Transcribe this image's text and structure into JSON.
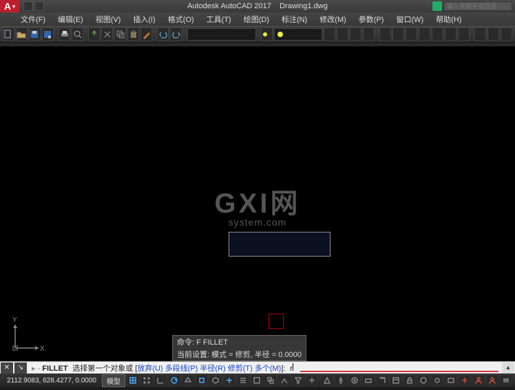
{
  "app": {
    "name": "Autodesk AutoCAD 2017",
    "document": "Drawing1.dwg",
    "search_placeholder": "输入关键字或短语"
  },
  "menu": [
    "文件(F)",
    "编辑(E)",
    "视图(V)",
    "插入(I)",
    "格式(O)",
    "工具(T)",
    "绘图(D)",
    "标注(N)",
    "修改(M)",
    "参数(P)",
    "窗口(W)",
    "帮助(H)"
  ],
  "watermark": {
    "line1": "GXI网",
    "line2": "system.com"
  },
  "ucs": {
    "x_label": "X",
    "y_label": "Y"
  },
  "command_history": [
    "命令: F FILLET",
    "当前设置: 模式 = 修剪, 半径 = 0.0000"
  ],
  "command_line": {
    "cmd": "FILLET",
    "prompt_pre": "选择第一个对象或 [",
    "options": [
      {
        "label": "放弃",
        "key": "U"
      },
      {
        "label": "多段线",
        "key": "P"
      },
      {
        "label": "半径",
        "key": "R"
      },
      {
        "label": "修剪",
        "key": "T"
      },
      {
        "label": "多个",
        "key": "M"
      }
    ],
    "prompt_post": "]:",
    "input": "r"
  },
  "status": {
    "coords": "2112.9083, 628.4277, 0.0000",
    "model_tab": "模型"
  },
  "icons": {
    "new": "new",
    "open": "open",
    "save": "save",
    "print": "print",
    "undo": "undo",
    "redo": "redo"
  }
}
